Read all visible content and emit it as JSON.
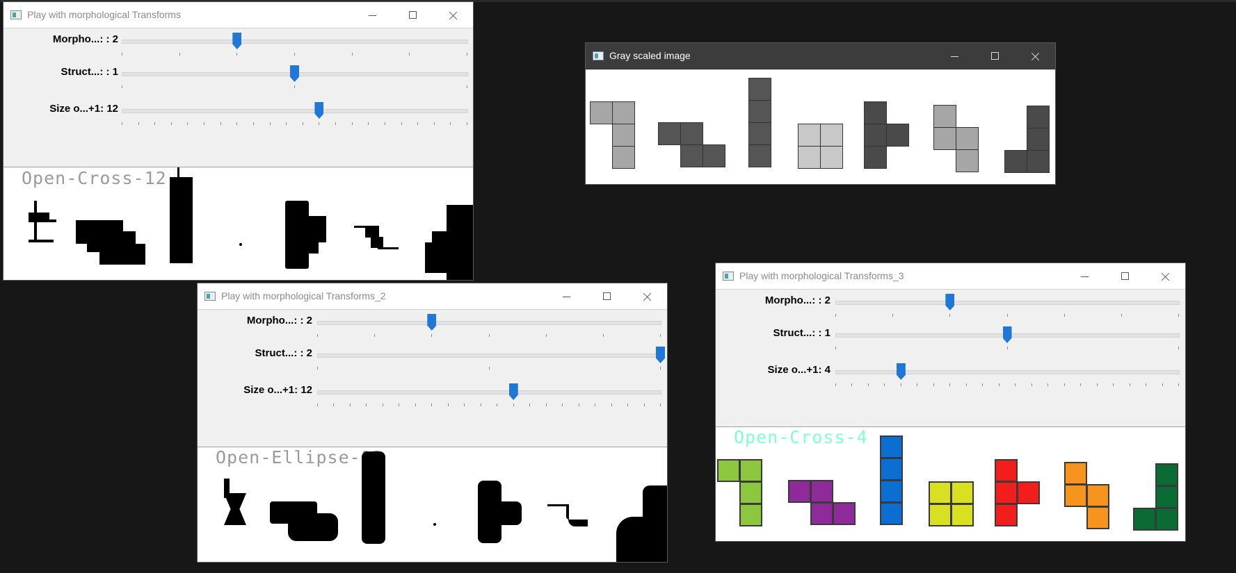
{
  "windows": {
    "w1": {
      "title": "Play with morphological Transforms",
      "trackbars": [
        {
          "label": "Morpho...: : 2",
          "value": 2,
          "max": 6
        },
        {
          "label": "Struct...: : 1",
          "value": 1,
          "max": 2
        },
        {
          "label": "Size o...+1: 12",
          "value": 12,
          "max": 21
        }
      ],
      "overlay_text": "Open-Cross-12",
      "overlay_color": "#9a9a9a"
    },
    "w2": {
      "title": "Play with morphological Transforms_2",
      "trackbars": [
        {
          "label": "Morpho...: : 2",
          "value": 2,
          "max": 6
        },
        {
          "label": "Struct...: : 2",
          "value": 2,
          "max": 2
        },
        {
          "label": "Size o...+1: 12",
          "value": 12,
          "max": 21
        }
      ],
      "overlay_text": "Open-Ellipse-12",
      "overlay_color": "#9a9a9a"
    },
    "w3": {
      "title": "Gray scaled image"
    },
    "w4": {
      "title": "Play with morphological Transforms_3",
      "trackbars": [
        {
          "label": "Morpho...: : 2",
          "value": 2,
          "max": 6
        },
        {
          "label": "Struct...: : 1",
          "value": 1,
          "max": 2
        },
        {
          "label": "Size o...+1: 4",
          "value": 4,
          "max": 21
        }
      ],
      "overlay_text": "Open-Cross-4",
      "overlay_color": "#7fffd4"
    }
  },
  "colors": {
    "background": "#171717",
    "trackbar_thumb": "#1f77d6",
    "piece_green": "#8dc63f",
    "piece_purple": "#8e2a9a",
    "piece_blue": "#0a6fd0",
    "piece_yellow": "#d9e021",
    "piece_red": "#f21d1d",
    "piece_orange": "#f7941d",
    "piece_darkgreen": "#0a6b35",
    "gray_light": "#a6a6a6",
    "gray_dark": "#555555",
    "gray_lightest": "#c8c8c8"
  }
}
